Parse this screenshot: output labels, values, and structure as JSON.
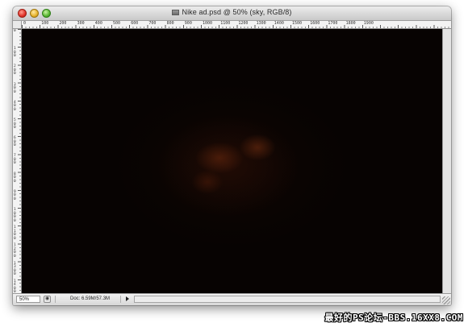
{
  "window": {
    "title": "Nike ad.psd @ 50% (sky, RGB/8)",
    "controls": {
      "close": "close",
      "minimize": "minimize",
      "zoom": "zoom"
    }
  },
  "rulers": {
    "horizontal_ticks": [
      "0",
      "100",
      "200",
      "300",
      "400",
      "500",
      "600",
      "700",
      "800",
      "900",
      "1000",
      "1100",
      "1200",
      "1300",
      "1400",
      "1500",
      "1600",
      "1700",
      "1800",
      "1900"
    ],
    "vertical_ticks": [
      "0",
      "100",
      "200",
      "300",
      "400",
      "500",
      "600",
      "700",
      "800",
      "900",
      "1000",
      "1100",
      "1200",
      "1300",
      "1400"
    ]
  },
  "canvas": {
    "layer": "sky",
    "background_color": "#070302",
    "glow_color": "#6e2a0e"
  },
  "statusbar": {
    "zoom": "50%",
    "doc_info": "Doc: 6.59M/57.3M"
  },
  "watermark": "最好的PS论坛-BBS.16XX8.COM"
}
